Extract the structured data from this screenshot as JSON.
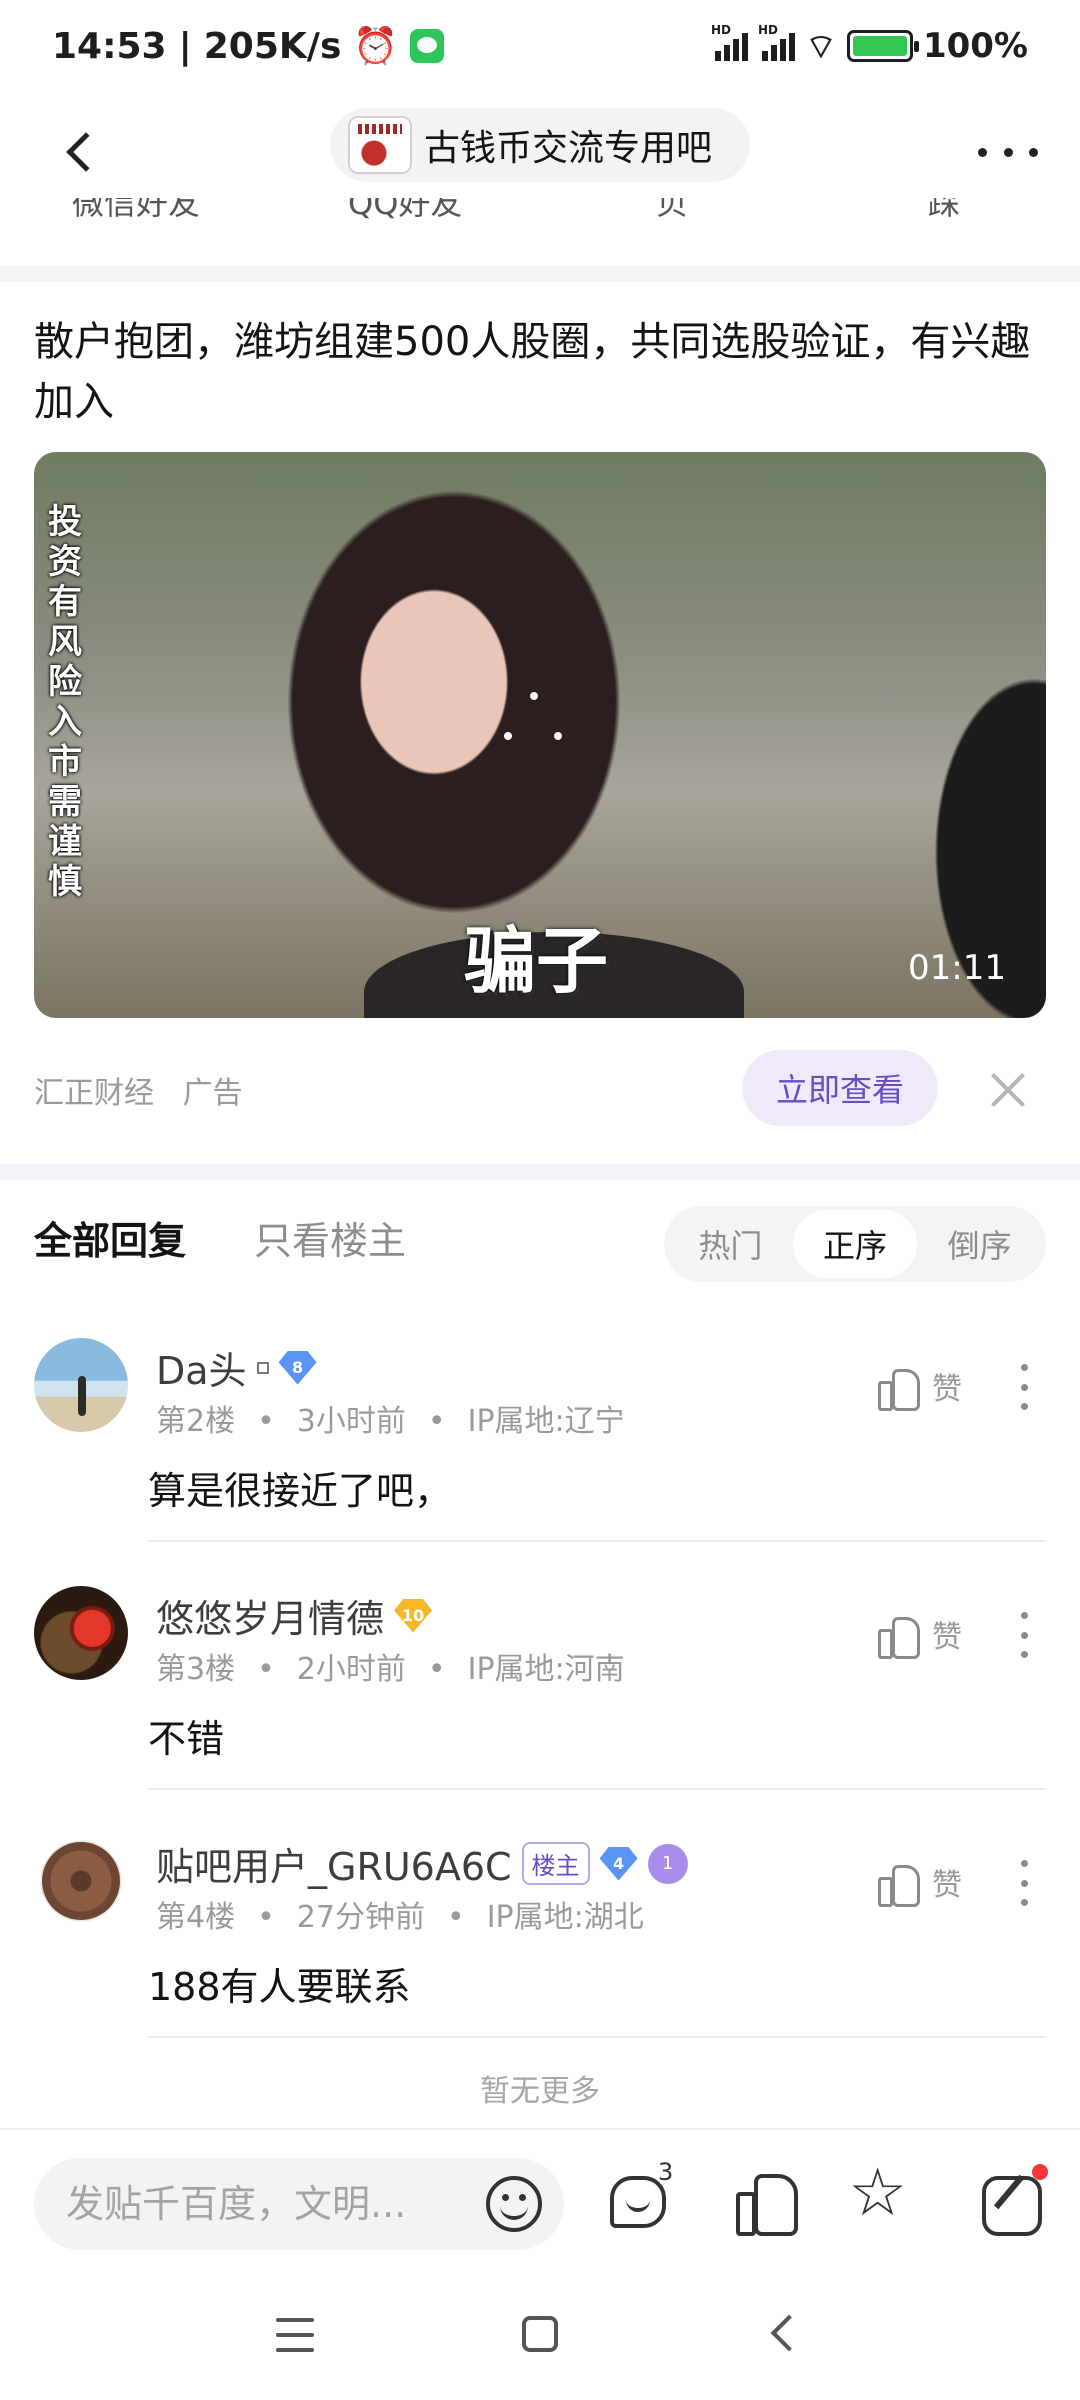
{
  "status_bar": {
    "time": "14:53",
    "net_speed": "205K/s",
    "battery": "100%",
    "signal1": "HD",
    "signal2": "HD"
  },
  "navbar": {
    "forum_name": "古钱币交流专用吧"
  },
  "cut_strip": [
    "微信好友",
    "QQ好友",
    "贝",
    "踩"
  ],
  "ad": {
    "title": "散户抱团，潍坊组建500人股圈，共同选股验证，有兴趣加入",
    "video_vertical_caption": "投资有风险 入市需谨慎",
    "video_subtitle": "骗子",
    "duration": "01:11",
    "advertiser": "汇正财经",
    "ad_label": "广告",
    "cta": "立即查看"
  },
  "replies_header": {
    "all": "全部回复",
    "owner_only": "只看楼主",
    "sort_options": [
      "热门",
      "正序",
      "倒序"
    ],
    "active_sort": "正序"
  },
  "comments": [
    {
      "username": "Da头",
      "level": "8",
      "floor": "第2楼",
      "time": "3小时前",
      "ip": "IP属地:辽宁",
      "like_label": "赞",
      "text": "算是很接近了吧，"
    },
    {
      "username": "悠悠岁月情德",
      "level": "10",
      "floor": "第3楼",
      "time": "2小时前",
      "ip": "IP属地:河南",
      "like_label": "赞",
      "text": "不错"
    },
    {
      "username": "贴吧用户_GRU6A6C",
      "owner_tag": "楼主",
      "level": "4",
      "medal": "1",
      "floor": "第4楼",
      "time": "27分钟前",
      "ip": "IP属地:湖北",
      "like_label": "赞",
      "text": "188有人要联系"
    }
  ],
  "no_more": "暂无更多",
  "bottom_bar": {
    "compose_placeholder": "发贴千百度，文明...",
    "reply_count": "3"
  },
  "colors": {
    "accent": "#6a4cc2",
    "cta_bg": "#efe9fb",
    "notification": "#f4373a"
  }
}
